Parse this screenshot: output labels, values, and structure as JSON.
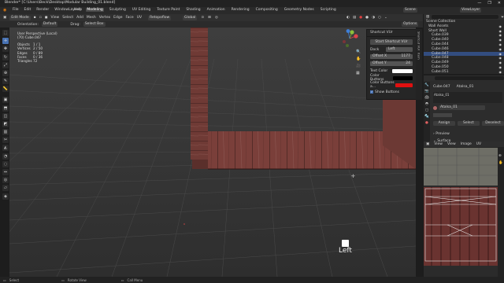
{
  "window": {
    "title": "Blender* [C:\\Users\\Beck\\Desktop\\Modular Building_01.blend]",
    "controls": [
      "—",
      "❐",
      "✕"
    ]
  },
  "menu": {
    "items": [
      "File",
      "Edit",
      "Render",
      "Window",
      "Help"
    ],
    "tabs": [
      "Layout",
      "Modeling",
      "Sculpting",
      "UV Editing",
      "Texture Paint",
      "Shading",
      "Animation",
      "Rendering",
      "Compositing",
      "Geometry Nodes",
      "Scripting"
    ],
    "active_tab": "Modeling",
    "scene": "Scene",
    "view_layer": "ViewLayer"
  },
  "header": {
    "mode": "Edit Mode",
    "menus": [
      "View",
      "Select",
      "Add",
      "Mesh",
      "Vertex",
      "Edge",
      "Face",
      "UV"
    ],
    "transform": "Global",
    "snap_mode": "Retopoflow",
    "orientation_label": "Orientation:",
    "orientation_value": "Default",
    "drag_label": "Drag:",
    "drag_value": "Select Box",
    "options": "Options"
  },
  "viewport": {
    "view_name": "User Perspective (Local)",
    "object": "(70) Cube.047",
    "stats": [
      {
        "label": "Objects",
        "value": "1 / 1"
      },
      {
        "label": "Vertices",
        "value": "2 / 50"
      },
      {
        "label": "Edges",
        "value": "0 / 89"
      },
      {
        "label": "Faces",
        "value": "0 / 36"
      },
      {
        "label": "Triangles",
        "value": "72"
      }
    ],
    "caption": "Left",
    "gizmo_axes": [
      "X",
      "Y",
      "Z"
    ]
  },
  "npanel": {
    "title": "Shortcut VUr",
    "start_button": "Start Shortcut VUr",
    "dock_label": "Dock",
    "dock_value": "Left",
    "offset_x_label": "Offset X",
    "offset_x_value": "1177",
    "offset_y_label": "Offset Y",
    "offset_y_value": "24",
    "text_color_label": "Text Color",
    "color_buttons_label": "Color Buttons",
    "color_buttons_a_label": "Color Buttons a...",
    "show_buttons_label": "Show Buttons",
    "text_color": "#ffffff",
    "color_buttons": "#000000",
    "color_buttons_a": "#e01010",
    "tabs": [
      "Shortcut VUr",
      "Item",
      "Tool",
      "View"
    ]
  },
  "outliner": {
    "collection": "Scene Collection",
    "items": [
      {
        "name": "Wall Assets",
        "selected": false
      },
      {
        "name": "Short Wall",
        "selected": false
      },
      {
        "name": "Cube.039",
        "selected": false
      },
      {
        "name": "Cube.040",
        "selected": false
      },
      {
        "name": "Cube.044",
        "selected": false
      },
      {
        "name": "Cube.046",
        "selected": false
      },
      {
        "name": "Cube.047",
        "selected": true
      },
      {
        "name": "Cube.048",
        "selected": false
      },
      {
        "name": "Cube.049",
        "selected": false
      },
      {
        "name": "Cube.050",
        "selected": false
      },
      {
        "name": "Cube.051",
        "selected": false
      }
    ]
  },
  "properties": {
    "object_name": "Cube.047",
    "material_name": "Atalsa_01",
    "slot_name": "Atalsa_01",
    "material_field": "Atalsa_01",
    "buttons": [
      "Assign",
      "Select",
      "Deselect"
    ],
    "sections": [
      "Preview",
      "Surface"
    ]
  },
  "image_editor": {
    "menus": [
      "View",
      "View",
      "Image",
      "UV"
    ]
  },
  "status": {
    "items": [
      "Select",
      "Rotate View",
      "Call Menu"
    ]
  }
}
